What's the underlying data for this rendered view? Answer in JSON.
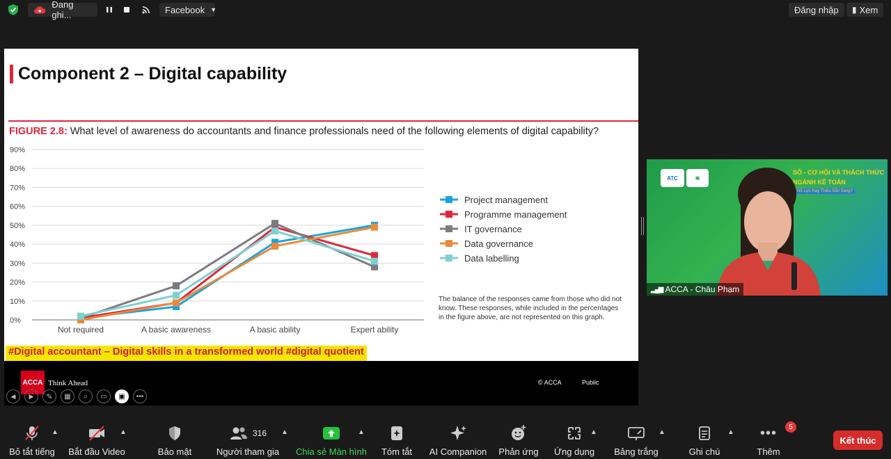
{
  "topbar": {
    "recording_label": "Đang ghi...",
    "share_target": "Facebook",
    "signin_label": "Đăng nhập",
    "view_label": "Xem"
  },
  "slide": {
    "title": "Component 2 – Digital capability",
    "figure_label": "FIGURE 2.8:",
    "figure_question": "What level of awareness do accountants and finance professionals need of the following elements of digital capability?",
    "note": [
      "The balance of the responses came from those who did not",
      "know. These responses, while included in the percentages",
      "in the figure above, are not represented on this graph."
    ],
    "hashtag_banner": "#Digital accountant – Digital skills in a transformed world  #digital quotient",
    "footer_brand": "ACCA",
    "footer_tagline": "Think Ahead",
    "footer_copyright": "© ACCA",
    "footer_public": "Public"
  },
  "chart_data": {
    "type": "line",
    "categories": [
      "Not required",
      "A basic awareness",
      "A basic ability",
      "Expert ability"
    ],
    "y_ticks": [
      "0%",
      "10%",
      "20%",
      "30%",
      "40%",
      "50%",
      "60%",
      "70%",
      "80%",
      "90%"
    ],
    "ylim": [
      0,
      90
    ],
    "series": [
      {
        "name": "Project management",
        "color": "#1ba3df",
        "values": [
          1,
          7,
          41,
          50
        ]
      },
      {
        "name": "Programme management",
        "color": "#e0263a",
        "values": [
          1,
          9,
          49,
          34
        ]
      },
      {
        "name": "IT governance",
        "color": "#7b7c80",
        "values": [
          1,
          18,
          51,
          28
        ]
      },
      {
        "name": "Data governance",
        "color": "#e98b3a",
        "values": [
          0,
          9,
          39,
          49
        ]
      },
      {
        "name": "Data labelling",
        "color": "#7dd1cf",
        "values": [
          2,
          13,
          47,
          31
        ]
      }
    ],
    "legend_position": "top-right",
    "grid": true
  },
  "video": {
    "participant_name": "ACCA - Châu Phạm",
    "bg_caption_1": "SỐ - CƠ HỘI VÀ THÁCH THỨC",
    "bg_caption_2": "NGÀNH KẾ TOÁN",
    "bg_caption_3": "Nỗ Lực Hay Thiếu Sẵn Sàng?"
  },
  "toolbar": {
    "mute": "Bỏ tắt tiếng",
    "video": "Bắt đầu Video",
    "security": "Bảo mật",
    "participants": "Người tham gia",
    "participants_count": "316",
    "share": "Chia sẻ Màn hình",
    "summary": "Tóm tắt",
    "ai": "AI Companion",
    "reactions": "Phản ứng",
    "apps": "Ứng dụng",
    "whiteboard": "Bảng trắng",
    "notes": "Ghi chú",
    "more": "Thêm",
    "more_badge": "5",
    "end": "Kết thúc"
  }
}
